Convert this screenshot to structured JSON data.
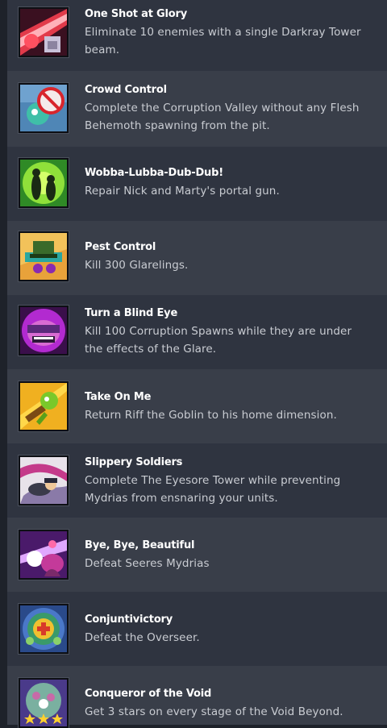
{
  "achievements": [
    {
      "title": "One Shot at Glory",
      "description": "Eliminate 10 enemies with a single Darkray Tower beam.",
      "icon": "red-laser-beam-icon"
    },
    {
      "title": "Crowd Control",
      "description": "Complete the Corruption Valley without any Flesh Behemoth spawning from the pit.",
      "icon": "no-monster-sign-icon"
    },
    {
      "title": "Wobba-Lubba-Dub-Dub!",
      "description": "Repair Nick and Marty's portal gun.",
      "icon": "portal-silhouettes-icon"
    },
    {
      "title": "Pest Control",
      "description": "Kill 300 Glarelings.",
      "icon": "pest-creature-icon"
    },
    {
      "title": "Turn a Blind Eye",
      "description": "Kill 100 Corruption Spawns while they are under the effects of the Glare.",
      "icon": "blindfolded-creature-icon"
    },
    {
      "title": "Take On Me",
      "description": "Return Riff the Goblin to his home dimension.",
      "icon": "goblin-guitar-icon"
    },
    {
      "title": "Slippery Soldiers",
      "description": "Complete The Eyesore Tower while preventing Mydrias from ensnaring your units.",
      "icon": "tentacle-soldier-icon"
    },
    {
      "title": "Bye, Bye, Beautiful",
      "description": "Defeat Seeres Mydrias",
      "icon": "mydrias-defeat-icon"
    },
    {
      "title": "Conjuntivictory",
      "description": "Defeat the Overseer.",
      "icon": "overseer-eye-icon"
    },
    {
      "title": "Conqueror of the Void",
      "description": "Get 3 stars on every stage of the Void Beyond.",
      "icon": "three-stars-monster-icon"
    }
  ]
}
